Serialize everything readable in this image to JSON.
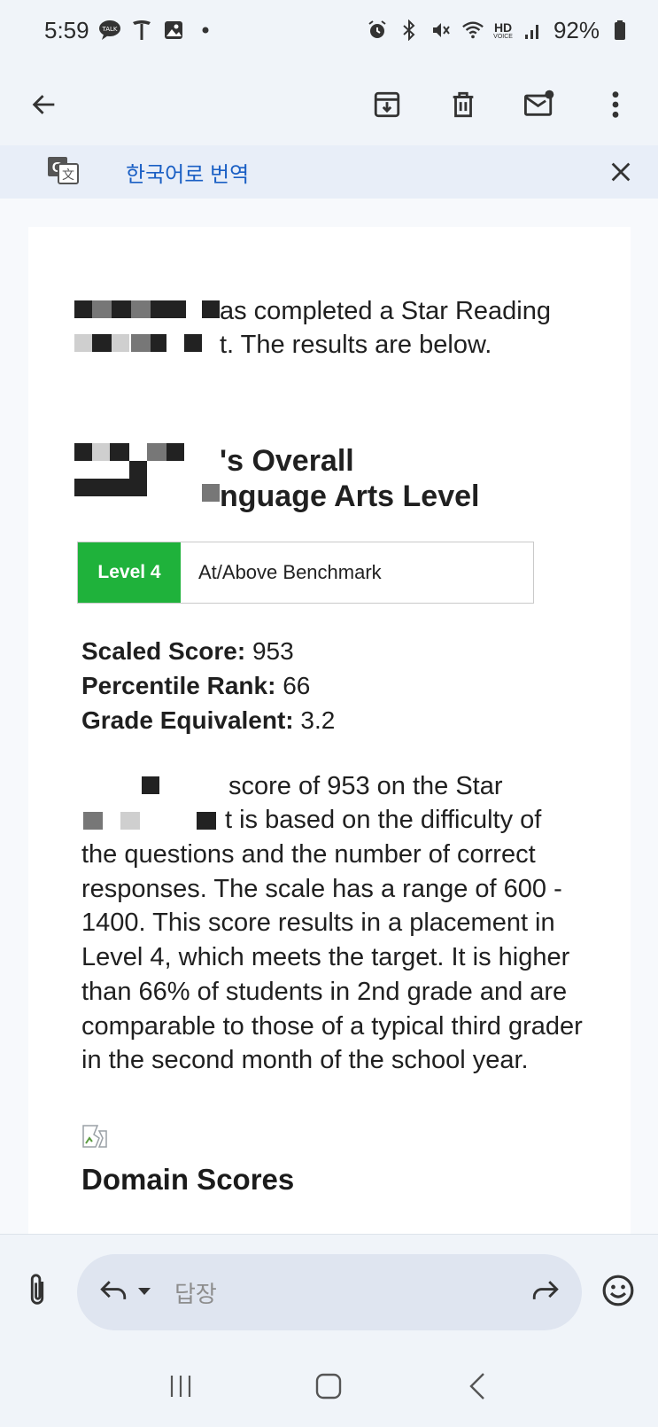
{
  "status_bar": {
    "time": "5:59",
    "left_icons": [
      "talk-icon",
      "tesla-icon",
      "gallery-icon",
      "dot-icon"
    ],
    "right_icons": [
      "alarm-icon",
      "bluetooth-icon",
      "mute-icon",
      "wifi-icon",
      "hd-voice-icon",
      "signal-icon",
      "battery-icon"
    ],
    "hd_label": "HD",
    "voice_label": "VOICE",
    "battery": "92%"
  },
  "app_bar": {
    "icons": [
      "back-arrow-icon",
      "archive-icon",
      "delete-icon",
      "mark-unread-icon",
      "more-vert-icon"
    ]
  },
  "translate_bar": {
    "label": "한국어로 번역",
    "icon": "translate-icon",
    "close_icon": "close-icon"
  },
  "email": {
    "intro_line1": "as completed a Star Reading",
    "intro_line2": "t. The results are below.",
    "heading_line1": "'s Overall",
    "heading_line2": "nguage Arts Level",
    "level_badge": "Level 4",
    "level_desc": "At/Above Benchmark",
    "scores": [
      {
        "label": "Scaled Score:",
        "value": " 953"
      },
      {
        "label": "Percentile Rank:",
        "value": " 66"
      },
      {
        "label": "Grade Equivalent:",
        "value": " 3.2"
      }
    ],
    "para_line1": "score of 953 on the Star",
    "para_line2": "t is based on the difficulty of",
    "para_rest": "the questions and the number of correct responses. The scale has a range of 600 - 1400. This score results in a placement in Level 4, which meets the target. It is higher than 66% of students in 2nd grade and are comparable to those of a typical third grader in the second month of the school year.",
    "domain_heading": "Domain Scores"
  },
  "reply_bar": {
    "placeholder": "답장",
    "icons": [
      "attach-icon",
      "reply-icon",
      "dropdown-icon",
      "forward-icon",
      "emoji-icon"
    ]
  },
  "nav_bar": {
    "icons": [
      "recents-icon",
      "home-icon",
      "back-icon"
    ]
  }
}
